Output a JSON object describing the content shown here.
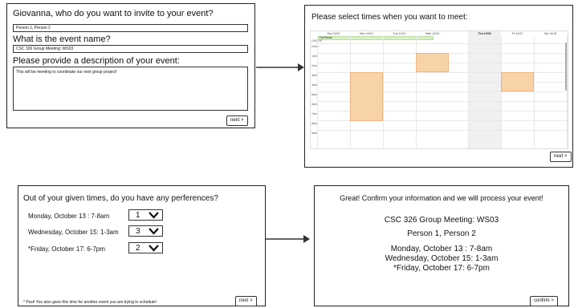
{
  "panel1": {
    "invite_question": "Giovanna, who do you want to invite to your event?",
    "invite_value": "Person 1, Person 2",
    "name_question": "What is the event name?",
    "name_value": "CSC 326 Group Meeting: WS03",
    "desc_question": "Please provide a description of your event:",
    "desc_value": "This will be meeting to coordinate our next group project!",
    "next_label": "next  >"
  },
  "panel2": {
    "title": "Please select times when you want to meet:",
    "tz_label": "GMT-05",
    "days": [
      "Sun 10/12",
      "Mon 10/13",
      "Tue 10/14",
      "Wed 10/15",
      "Thu 10/16",
      "Fri 10/17",
      "Sat 10/18"
    ],
    "times": [
      "12am",
      "1am",
      "2am",
      "3am",
      "4am",
      "5am",
      "6am",
      "7am",
      "8am",
      "9am"
    ],
    "allday_event": "Fall Break",
    "next_label": "next  >"
  },
  "panel3": {
    "title": "Out of your given times, do you have any perferences?",
    "prefs": [
      {
        "label": "Monday, October 13 : 7-8am",
        "value": "1"
      },
      {
        "label": "Wednesday, October 15: 1-3am",
        "value": "3"
      },
      {
        "label": "*Friday, October 17: 6-7pm",
        "value": "2"
      }
    ],
    "footnote": "* Psst! You also gave this time for another event you are trying to schedule!",
    "next_label": "next  >"
  },
  "panel4": {
    "title": "Great! Confirm your information and we will process your event!",
    "event_name": "CSC 326 Group Meeting: WS03",
    "invitees": "Person 1, Person 2",
    "time1": "Monday, October 13 : 7-8am",
    "time2": "Wednesday, October 15: 1-3am",
    "time3": "*Friday, October 17: 6-7pm",
    "confirm_label": "confirm  >"
  },
  "colors": {
    "slot": "#f9d3a8",
    "allday": "#d8f0c8",
    "today_col": "#f0f0f0"
  }
}
